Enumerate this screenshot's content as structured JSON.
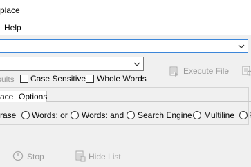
{
  "window": {
    "title": "place"
  },
  "menu": {
    "help": "Help"
  },
  "search": {
    "value": ""
  },
  "options_combo": {
    "value": ""
  },
  "results_label": "sults",
  "checkboxes": {
    "case_sensitive": "Case Sensitive",
    "whole_words": "Whole Words"
  },
  "buttons": {
    "execute_file": "Execute File",
    "stop": "Stop",
    "hide_list": "Hide List"
  },
  "tabs": {
    "replace": "ace",
    "options": "Options"
  },
  "search_mode": {
    "phrase": "rase",
    "words_or": "Words: or",
    "words_and": "Words: and",
    "search_engine": "Search Engine",
    "multiline": "Multiline",
    "cut": "R"
  },
  "colors": {
    "focus_border": "#3c86d9",
    "disabled_text": "#9a9a9a"
  }
}
